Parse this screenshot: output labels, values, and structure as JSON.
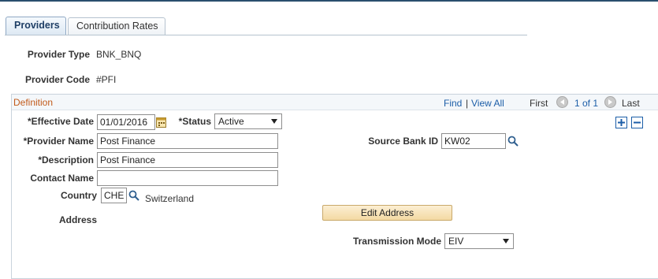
{
  "tabs": [
    {
      "label": "Providers",
      "active": true
    },
    {
      "label": "Contribution Rates",
      "active": false
    }
  ],
  "header": {
    "provider_type_label": "Provider Type",
    "provider_type_value": "BNK_BNQ",
    "provider_code_label": "Provider Code",
    "provider_code_value": "#PFI"
  },
  "definition": {
    "title": "Definition",
    "nav": {
      "find": "Find",
      "separator": "|",
      "view_all": "View All",
      "first": "First",
      "page": "1 of 1",
      "last": "Last"
    },
    "effective_date_label": "*Effective Date",
    "effective_date_value": "01/01/2016",
    "status_label": "*Status",
    "status_value": "Active",
    "provider_name_label": "*Provider Name",
    "provider_name_value": "Post Finance",
    "description_label": "*Description",
    "description_value": "Post Finance",
    "contact_name_label": "Contact Name",
    "contact_name_value": "",
    "country_label": "Country",
    "country_value": "CHE",
    "country_desc": "Switzerland",
    "address_label": "Address",
    "edit_address_label": "Edit Address",
    "source_bank_label": "Source Bank ID",
    "source_bank_value": "KW02",
    "transmission_label": "Transmission Mode",
    "transmission_value": "EIV"
  },
  "colors": {
    "accent": "#1c5ea8",
    "group_title": "#c25b1b",
    "button_fill": "#f3d9a3"
  }
}
